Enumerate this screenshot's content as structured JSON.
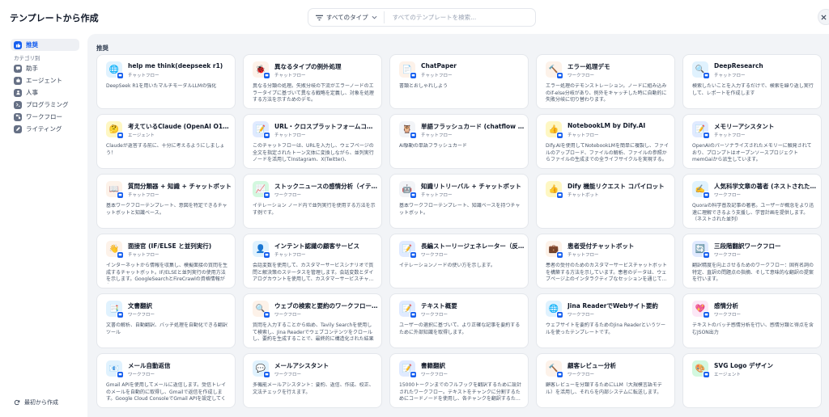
{
  "header": {
    "title": "テンプレートから作成",
    "type_filter_label": "すべてのタイプ",
    "search_placeholder": "すべてのテンプレートを検索..."
  },
  "sidebar": {
    "recommended_label": "推奨",
    "category_heading": "カテゴリ別",
    "categories": [
      {
        "label": "助手"
      },
      {
        "label": "エージェント"
      },
      {
        "label": "人事"
      },
      {
        "label": "プログラミング"
      },
      {
        "label": "ワークフロー"
      },
      {
        "label": "ライティング"
      }
    ],
    "bottom_label": "最初から作成"
  },
  "main": {
    "section_title": "推奨",
    "cards": [
      {
        "title": "help me think(deepseek r1)",
        "type": "チャットフロー",
        "icon": "🌐",
        "icon_bg": "#e0f2fe",
        "desc": "DeepSeek R1を用いたマルチモーダルLLMの強化"
      },
      {
        "title": "異なるタイプの例外処理",
        "type": "チャットフロー",
        "icon": "🐞",
        "icon_bg": "#fdf2e9",
        "desc": "異なる分類の処理。失敗分岐の下流がエラーノードのエラータイプに基づいて異なる戦略を定義し、対象を処理する方法を示すためのデモ。"
      },
      {
        "title": "ChatPaper",
        "type": "チャットフロー",
        "icon": "📄",
        "icon_bg": "#fdf2e9",
        "desc": "書類とおしゃれしよう"
      },
      {
        "title": "エラー処理デモ",
        "type": "ワークフロー",
        "icon": "🔨",
        "icon_bg": "#fdf2e9",
        "desc": "エラー処理のデモンストレーション。ノードに組み込みのif-else分岐があり、例外をキャッチした時に自動的に失敗分岐に切り替わります。"
      },
      {
        "title": "DeepResearch",
        "type": "チャットフロー",
        "icon": "🔍",
        "icon_bg": "#e0f2fe",
        "desc": "検索したいことを入力するだけで、検索を繰り返し実行して、レポートを作成します"
      },
      {
        "title": "考えているClaude (OpenAI O1代替品)",
        "type": "エージェント",
        "icon": "🤔",
        "icon_bg": "#fef7c3",
        "desc": "Claudeが返答する前に、十分に考えるようにしましょう！"
      },
      {
        "title": "URL・クロスプラットフォームコピーライ…",
        "type": "チャットフロー",
        "icon": "📝",
        "icon_bg": "#e0eaff",
        "desc": "このチャットフローは、URLを入力し、ウェブページの全文を指定されたトーン文体に変換しながら、並列実行ノードを活用してInstagram、X(Twitter)、Threads、…"
      },
      {
        "title": "単語フラッシュカード (chatflow ver.)",
        "type": "チャットフロー",
        "icon": "🦉",
        "icon_bg": "#f2f4f7",
        "desc": "AI駆動の単語フラッシュカード"
      },
      {
        "title": "NotebookLM by Dify.AI",
        "type": "チャットフロー",
        "icon": "👍",
        "icon_bg": "#fef7c3",
        "desc": "Dify.AIを使用してNotebookLMを簡単に複製し、ファイルのアップロード、ファイルの解析、ファイルの参照からファイルの生成までの全ライフサイクルを実現する。"
      },
      {
        "title": "メモリーアシスタント",
        "type": "チャットフロー",
        "icon": "📝",
        "icon_bg": "#e0eaff",
        "desc": "OpenAIのパーソナライズされたメモリーに触発されており、プロンプトはオープンソースプロジェクトmemGaiから派生しています。"
      },
      {
        "title": "質問分類器 + 知識 + チャットボット",
        "type": "チャットフロー",
        "icon": "📖",
        "icon_bg": "#fdf2e9",
        "desc": "基本ワークフローテンプレート、意図を特定できるチャットボットと知識ベース。"
      },
      {
        "title": "ストックニュースの感情分析（イテレ…",
        "type": "ワークフロー",
        "icon": "📈",
        "icon_bg": "#d3f8df",
        "desc": "イテレーション ノード内で並列実行を使用する方法を示す例です。"
      },
      {
        "title": "知識リトリーバル + チャットボット",
        "type": "チャットフロー",
        "icon": "🤖",
        "icon_bg": "#f2f4f7",
        "desc": "基本ワークフローテンプレート、知識ベースを持つチャットボット。"
      },
      {
        "title": "Dify 機能リクエスト コパイロット",
        "type": "チャットボット",
        "icon": "👍",
        "icon_bg": "#fef7c3",
        "desc": ""
      },
      {
        "title": "人気科学文章の著者 (ネストされた並列)",
        "type": "ワークフロー",
        "icon": "✍️",
        "icon_bg": "#e0f2fe",
        "desc": "Quoraの科学普及記事の著者。ユーザーが概念をより迅速に理解できるよう支援し、学習計画を提供します。（ネストされた並列）"
      },
      {
        "title": "面接官 (IF/ELSE と並列実行)",
        "type": "チャットフロー",
        "icon": "👋",
        "icon_bg": "#fdf2e9",
        "desc": "インターネットから情報を収集し、模擬面接の質問を生成するチャットボット。IF/ELSEと並列実行の使用方法を示します。GoogleSearchとFireCrawlの資格情報が必…"
      },
      {
        "title": "インテント認識の顧客サービス",
        "type": "チャットフロー",
        "icon": "👤",
        "icon_bg": "#e0f2fe",
        "desc": "会話変数を使用して、カスタマーサービスシナリオで質問と解決策のステータスを管理します。会話変数とダイアログカウントを使用して、カスタマーサービスチャ…"
      },
      {
        "title": "長編ストーリージェネレーター（反復）",
        "type": "ワークフロー",
        "icon": "📝",
        "icon_bg": "#e0eaff",
        "desc": "イテレーションノードの使い方を示します。"
      },
      {
        "title": "患者受付チャットボット",
        "type": "チャットフロー",
        "icon": "💼",
        "icon_bg": "#fdf2e9",
        "desc": "患者の受付のためのカスタマーサービスチャットボットを構築する方法を示しています。患者のデータは、ウェブページ上のインタラクティブなセッションを通じて…"
      },
      {
        "title": "三段階翻訳ワークフロー",
        "type": "ワークフロー",
        "icon": "🔄",
        "icon_bg": "#e0eaff",
        "desc": "翻訳精度を向上させるためのワークフロー：固有名詞の特定、直訳の問題点の指摘、そして意味的な翻訳の提案を行います。"
      },
      {
        "title": "文書翻訳",
        "type": "ワークフロー",
        "icon": "📑",
        "icon_bg": "#e0f2fe",
        "desc": "文書の解析、自動翻訳、バッチ処理を自動化できる翻訳ツール"
      },
      {
        "title": "ウェブの検索と要約のワークフローパ…",
        "type": "ワークフロー",
        "icon": "🔍",
        "icon_bg": "#fdf2e9",
        "desc": "質問を入力することから始め、Tavily Searchを使用して検索し、Jina Readerでウェブコンテンツをクロールし、要約を生成することで、最終的に構造化された結果の…"
      },
      {
        "title": "テキスト概要",
        "type": "ワークフロー",
        "icon": "📝",
        "icon_bg": "#e0eaff",
        "desc": "ユーザーの選択に基づいて、より正確な記事を要約するために外部知識を取得します。"
      },
      {
        "title": "Jina ReaderでWebサイト要約",
        "type": "ワークフロー",
        "icon": "🌐",
        "icon_bg": "#e0f2fe",
        "desc": "ウェブサイトを要約するためのJina Readerというツールを使ったテンプレートです。"
      },
      {
        "title": "感情分析",
        "type": "ワークフロー",
        "icon": "💖",
        "icon_bg": "#fce7f6",
        "desc": "テキストのバッチ感情分析を行い、感情分類と得点を含むJSON出力"
      },
      {
        "title": "メール自動返信",
        "type": "ワークフロー",
        "icon": "📧",
        "icon_bg": "#e0f2fe",
        "desc": "Gmail APIを使用してメールに返信します。受信トレイのメールを自動的に取得し、Gmailで返信を作成します。Google Cloud ConsoleでGmail APIを設定してくださ…"
      },
      {
        "title": "メールアシスタント",
        "type": "ワークフロー",
        "icon": "💬",
        "icon_bg": "#e0f2fe",
        "desc": "多機能メールアシスタント：要約、返信、作成、校正、文法チェックを行えます。"
      },
      {
        "title": "書籍翻訳",
        "type": "ワークフロー",
        "icon": "📝",
        "icon_bg": "#e0eaff",
        "desc": "15000トークンまでのフルブックを翻訳するために設計されたワークフロー。テキストをチャンクに分割するためにコードノードを使用し、各チャンクを翻訳するた…"
      },
      {
        "title": "顧客レビュー分析",
        "type": "ワークフロー",
        "icon": "🔨",
        "icon_bg": "#fdf2e9",
        "desc": "顧客レビューを分類するためにLLM（大規模言語モデル）を活用し、それらを内部システムに転送します。"
      },
      {
        "title": "SVG Logo デザイン",
        "type": "エージェント",
        "icon": "🎨",
        "icon_bg": "#d3f8df",
        "desc": ""
      }
    ]
  }
}
